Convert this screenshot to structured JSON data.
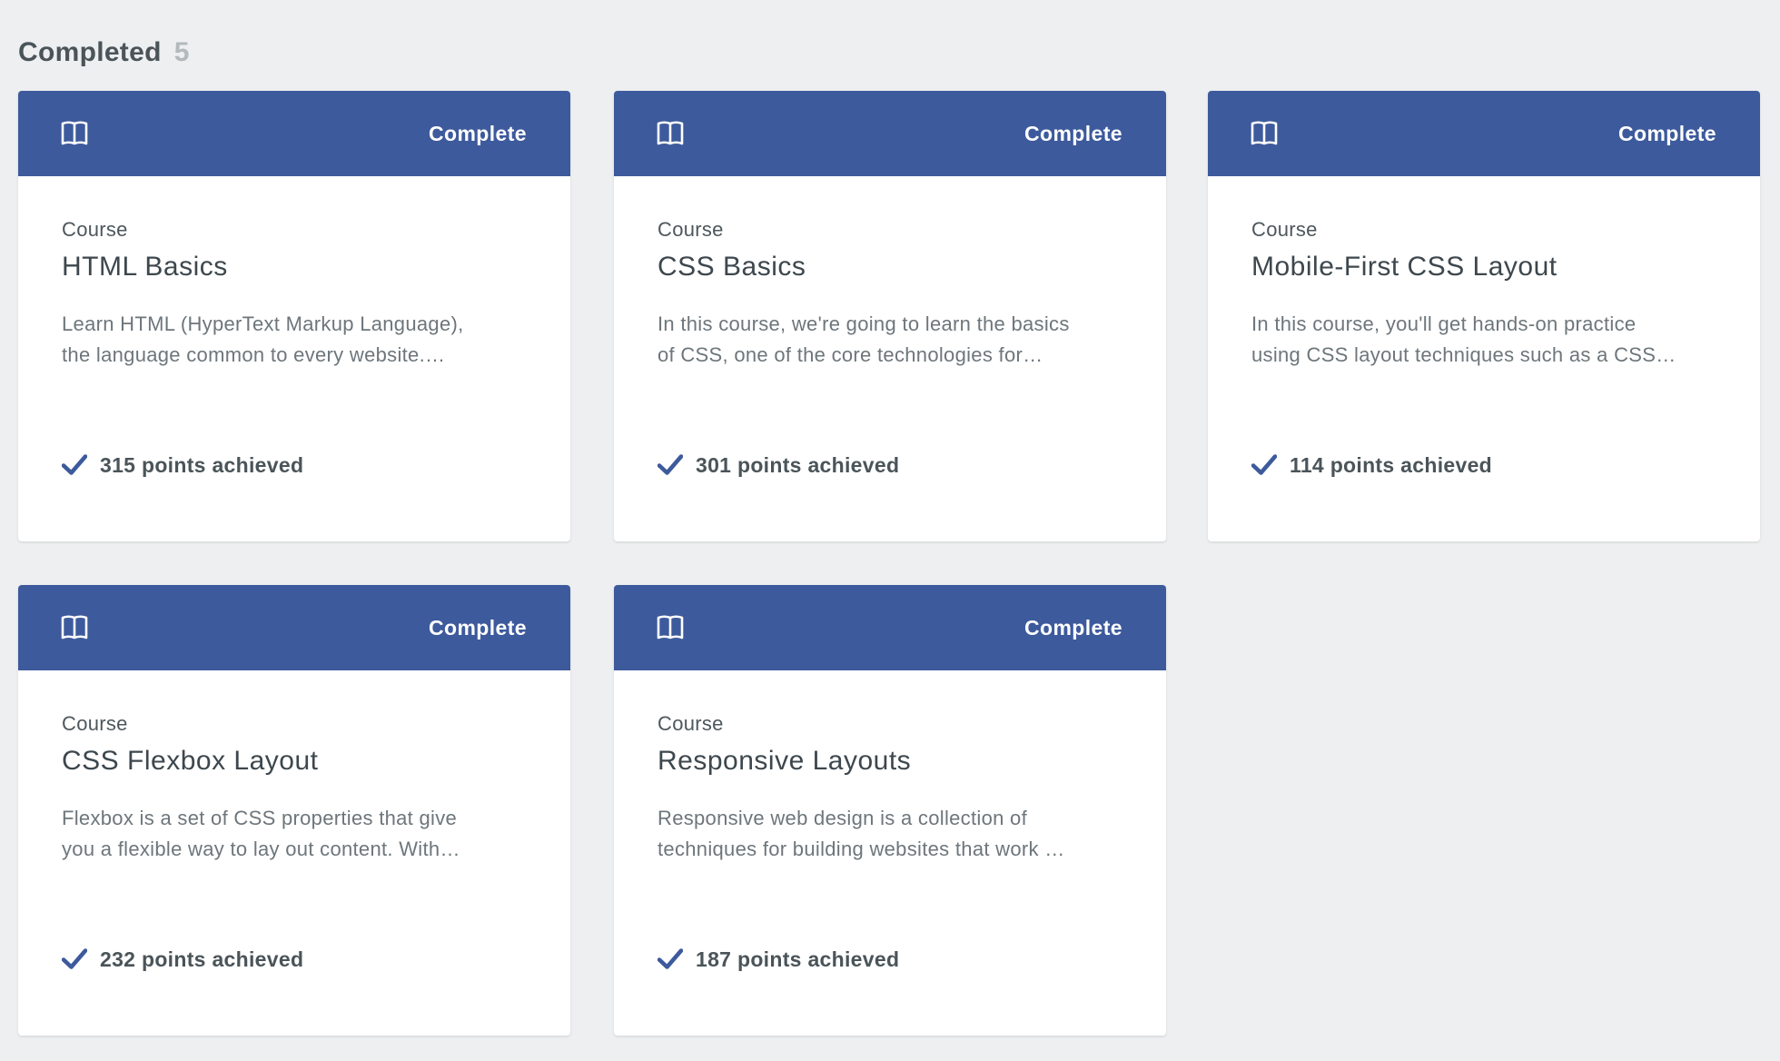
{
  "section": {
    "title": "Completed",
    "count": "5"
  },
  "colors": {
    "accent": "#3d5a9c",
    "background": "#eeeff1",
    "card": "#ffffff"
  },
  "cards": [
    {
      "status": "Complete",
      "icon": "book-icon",
      "type": "Course",
      "title": "HTML Basics",
      "desc_line1": "Learn HTML (HyperText Markup Language),",
      "desc_line2": "the language common to every website.…",
      "points": "315 points achieved"
    },
    {
      "status": "Complete",
      "icon": "book-icon",
      "type": "Course",
      "title": "CSS Basics",
      "desc_line1": "In this course, we're going to learn the basics",
      "desc_line2": "of CSS, one of the core technologies for…",
      "points": "301 points achieved"
    },
    {
      "status": "Complete",
      "icon": "book-icon",
      "type": "Course",
      "title": "Mobile-First CSS Layout",
      "desc_line1": "In this course, you'll get hands-on practice",
      "desc_line2": "using CSS layout techniques such as a CSS…",
      "points": "114 points achieved"
    },
    {
      "status": "Complete",
      "icon": "book-icon",
      "type": "Course",
      "title": "CSS Flexbox Layout",
      "desc_line1": "Flexbox is a set of CSS properties that give",
      "desc_line2": "you a flexible way to lay out content. With…",
      "points": "232 points achieved"
    },
    {
      "status": "Complete",
      "icon": "book-icon",
      "type": "Course",
      "title": "Responsive Layouts",
      "desc_line1": "Responsive web design is a collection of",
      "desc_line2": "techniques for building websites that work …",
      "points": "187 points achieved"
    }
  ]
}
